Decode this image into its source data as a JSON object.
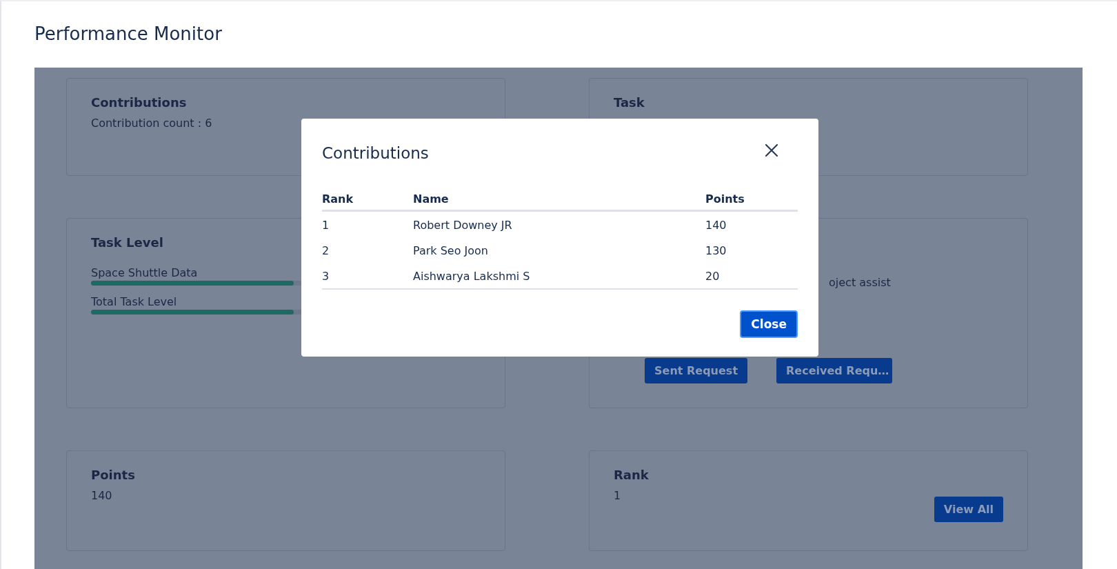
{
  "page_title": "Performance Monitor",
  "cards": [
    {
      "kind": "text",
      "title": "Contributions",
      "text": "Contribution count : 6"
    },
    {
      "kind": "text",
      "title": "Task"
    },
    {
      "kind": "levels",
      "title": "Task Level",
      "levels": [
        {
          "label": "Space Shuttle Data",
          "level": 0.52
        },
        {
          "label": "Total Task Level",
          "level": 0.52
        }
      ]
    },
    {
      "kind": "requests",
      "text": "oject assist",
      "buttons": [
        "Sent Request",
        "Received Requ…"
      ]
    },
    {
      "kind": "text",
      "title": "Points",
      "text": "140"
    },
    {
      "kind": "text",
      "title": "Rank",
      "text": "1",
      "button": "View All"
    }
  ],
  "modal": {
    "title": "Contributions",
    "columns": [
      "Rank",
      "Name",
      "Points"
    ],
    "rows": [
      [
        "1",
        "Robert Downey JR",
        "140"
      ],
      [
        "2",
        "Park Seo Joon",
        "130"
      ],
      [
        "3",
        "Aishwarya Lakshmi S",
        "20"
      ]
    ],
    "button": "Close"
  }
}
